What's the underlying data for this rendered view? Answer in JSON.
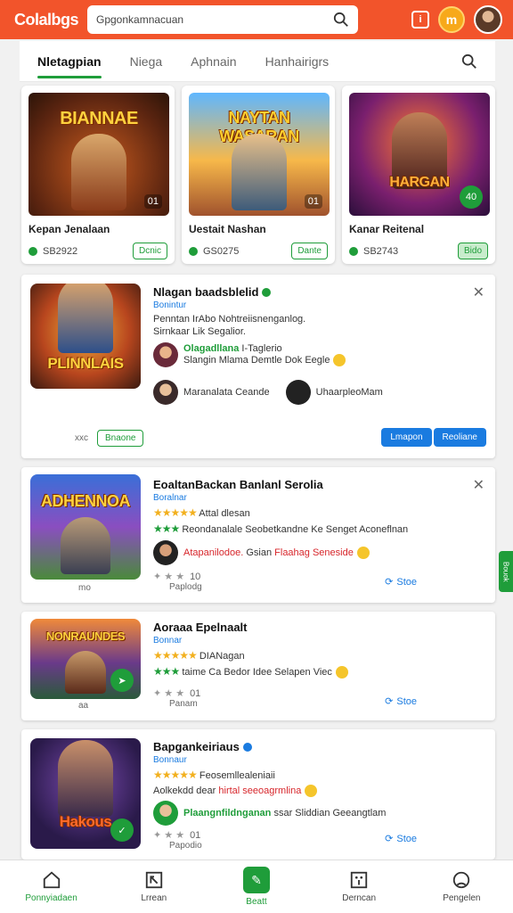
{
  "header": {
    "app_title": "Colalbgs",
    "search_value": "Gpgonkamnacuan",
    "badge_icon_text": "i",
    "coin_text": "m"
  },
  "tabs": [
    {
      "label": "Nletagpian"
    },
    {
      "label": "Niega"
    },
    {
      "label": "Aphnain"
    },
    {
      "label": "Hanhairigrs"
    }
  ],
  "featured": [
    {
      "art_title": "BIANNAE",
      "name": "Kepan Jenalaan",
      "meta": "SB2922",
      "button": "Dcnic",
      "badge": "01"
    },
    {
      "art_title": "NAYTAN WASARAN",
      "name": "Uestait Nashan",
      "meta": "GS0275",
      "button": "Dante",
      "badge": "01"
    },
    {
      "art_title": "HARGAN",
      "name": "Kanar Reitenal",
      "meta": "SB2743",
      "button": "Bido",
      "badge": "40"
    }
  ],
  "card1": {
    "art_title": "PLINNLAIS",
    "title": "Nlagan baadsblelid",
    "sub": "Bonintur",
    "line1": "Penntan IrAbo  Nohtreiisnenganlog.",
    "line2": "Sirnkaar Lik Segalior.",
    "user1_name": "Olagadllana",
    "user1_tag": "I-Taglerio",
    "line3": "Slangin Mlama  Demtle Dok Eegle",
    "user2_name": "Maranalata Ceande",
    "user3_name": "UhaarpleoMam",
    "btn_left_note": "xxc",
    "btn_green": "Bnaone",
    "btn_blue1": "Lmapon",
    "btn_blue2": "Reoliane"
  },
  "card2": {
    "art_title": "ADHENNOA",
    "title": "EoaltanBackan Banlanl Serolia",
    "sub": "Boralnar",
    "rating_text": "Attal dlesan",
    "line2": "Reondanalale Seobetkandne Ke Senget Aconeflnan",
    "user_name": "Atapanilodoe.",
    "user_extra": "Gsian",
    "red_text": "Flaahag Seneside",
    "count": "10",
    "note": "Paplodg",
    "store": "Stoe",
    "footer_note": "mo"
  },
  "card3": {
    "art_title": "NONRAUNDES",
    "title": "Aoraaa Epelnaalt",
    "sub": "Bonnar",
    "rating_text": "DIANagan",
    "line2": "taime Ca Bedor Idee Selapen Viec",
    "count": "01",
    "note": "Panam",
    "store": "Stoe",
    "footer_note": "aa"
  },
  "card4": {
    "art_title": "Hakous",
    "title": "Bapgankeiriaus",
    "sub": "Bonnaur",
    "rating_text": "Feosemllealeniaii",
    "line2_prefix": "Aolkekdd dear",
    "line2_red": "hirtal seeoagrmlina",
    "user_name": "Plaangnfildnganan",
    "user_rest": "ssar Sliddian Geeangtlam",
    "count": "01",
    "note": "Papodio",
    "store": "Stoe"
  },
  "side_tab": "Bouok",
  "bottom_nav": [
    {
      "label": "Ponnyiadaen"
    },
    {
      "label": "Lrrean"
    },
    {
      "label": "Beatt"
    },
    {
      "label": "Derncan"
    },
    {
      "label": "Pengelen"
    }
  ],
  "colors": {
    "header": "#f2542b",
    "accent_green": "#1f9d3a",
    "accent_blue": "#1a7be0"
  }
}
